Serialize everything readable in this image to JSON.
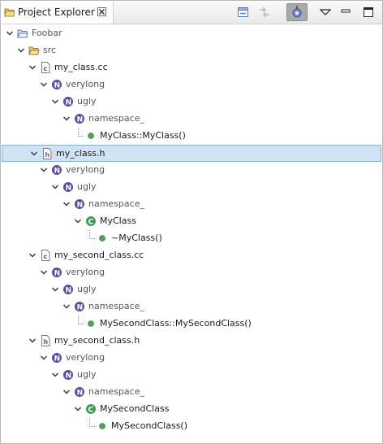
{
  "view": {
    "title": "Project Explorer",
    "toolbar": {
      "collapse_all": "collapse-all-icon",
      "link_editor": "link-with-editor-icon",
      "filter": "filter-icon",
      "view_menu": "view-menu-icon",
      "minimize": "minimize-icon",
      "maximize": "maximize-icon"
    }
  },
  "tree": [
    {
      "label": "Foobar",
      "icon": "project-folder-icon",
      "muted": true
    },
    {
      "label": "src",
      "icon": "source-folder-icon",
      "muted": true
    },
    {
      "label": "my_class.cc",
      "icon": "cc-file-icon"
    },
    {
      "label": "verylong",
      "icon": "namespace-icon",
      "muted": true
    },
    {
      "label": "ugly",
      "icon": "namespace-icon",
      "muted": true
    },
    {
      "label": "namespace_",
      "icon": "namespace-icon",
      "muted": true
    },
    {
      "label": "MyClass::MyClass()",
      "icon": "method-icon"
    },
    {
      "label": "my_class.h",
      "icon": "header-file-icon",
      "selected": true
    },
    {
      "label": "verylong",
      "icon": "namespace-icon",
      "muted": true
    },
    {
      "label": "ugly",
      "icon": "namespace-icon",
      "muted": true
    },
    {
      "label": "namespace_",
      "icon": "namespace-icon",
      "muted": true
    },
    {
      "label": "MyClass",
      "icon": "class-icon"
    },
    {
      "label": "~MyClass()",
      "icon": "method-icon"
    },
    {
      "label": "my_second_class.cc",
      "icon": "cc-file-icon"
    },
    {
      "label": "verylong",
      "icon": "namespace-icon",
      "muted": true
    },
    {
      "label": "ugly",
      "icon": "namespace-icon",
      "muted": true
    },
    {
      "label": "namespace_",
      "icon": "namespace-icon",
      "muted": true
    },
    {
      "label": "MySecondClass::MySecondClass()",
      "icon": "method-icon"
    },
    {
      "label": "my_second_class.h",
      "icon": "header-file-icon"
    },
    {
      "label": "verylong",
      "icon": "namespace-icon",
      "muted": true
    },
    {
      "label": "ugly",
      "icon": "namespace-icon",
      "muted": true
    },
    {
      "label": "namespace_",
      "icon": "namespace-icon",
      "muted": true
    },
    {
      "label": "MySecondClass",
      "icon": "class-icon"
    },
    {
      "label": "MySecondClass()",
      "icon": "method-icon"
    }
  ],
  "colors": {
    "selection_bg": "#cfe3f5",
    "namespace": "#5b4d9e",
    "class": "#3f9b56",
    "method": "#52a35f"
  }
}
